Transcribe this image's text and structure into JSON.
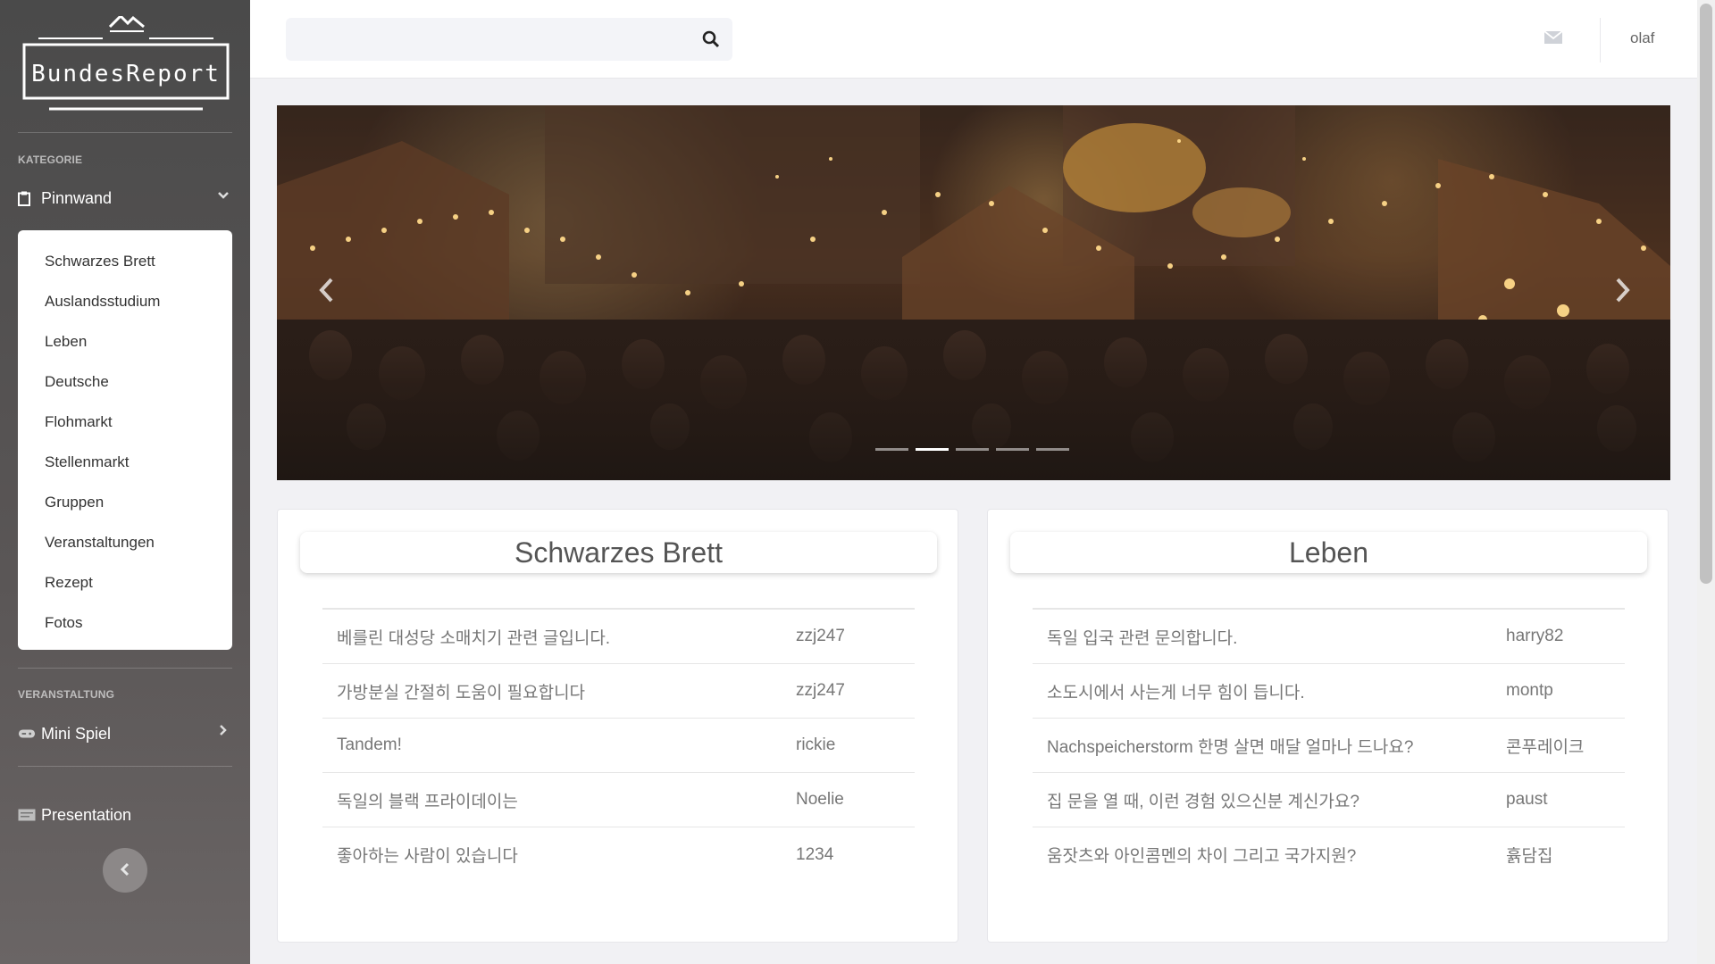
{
  "sidebar": {
    "logo_text": "BundesReport",
    "section_kategorie": "KATEGORIE",
    "pinnwand_label": "Pinnwand",
    "submenu": [
      "Schwarzes Brett",
      "Auslandsstudium",
      "Leben",
      "Deutsche",
      "Flohmarkt",
      "Stellenmarkt",
      "Gruppen",
      "Veranstaltungen",
      "Rezept",
      "Fotos"
    ],
    "section_veranstaltung": "VERANSTALTUNG",
    "mini_spiel_label": "Mini Spiel",
    "presentation_label": "Presentation",
    "icons": {
      "pinnwand": "clipboard-icon",
      "mini_spiel": "gamepad-icon",
      "presentation": "presentation-icon",
      "collapse": "chevron-left-icon"
    }
  },
  "header": {
    "search_placeholder": "",
    "search_value": "",
    "user_name": "olaf",
    "icons": {
      "search": "search-icon",
      "mail": "envelope-icon"
    }
  },
  "carousel": {
    "slide_count": 5,
    "active_index": 1
  },
  "cards": [
    {
      "title": "Schwarzes Brett",
      "posts": [
        {
          "title": "베를린 대성당 소매치기 관련 글입니다.",
          "author": "zzj247"
        },
        {
          "title": "가방분실 간절히 도움이 필요합니다",
          "author": "zzj247"
        },
        {
          "title": "Tandem!",
          "author": "rickie"
        },
        {
          "title": "독일의 블랙 프라이데이는",
          "author": "Noelie"
        },
        {
          "title": "좋아하는 사람이 있습니다",
          "author": "1234"
        }
      ]
    },
    {
      "title": "Leben",
      "posts": [
        {
          "title": "독일 입국 관련 문의합니다.",
          "author": "harry82"
        },
        {
          "title": "소도시에서 사는게 너무 힘이 듭니다.",
          "author": "montp"
        },
        {
          "title": "Nachspeicherstorm 한명 살면 매달 얼마나 드나요?",
          "author": "콘푸레이크"
        },
        {
          "title": "집 문을 열 때, 이런 경험 있으신분 계신가요?",
          "author": "paust"
        },
        {
          "title": "움잣츠와 아인콤멘의 차이 그리고 국가지원?",
          "author": "휽담집"
        }
      ]
    }
  ],
  "colors": {
    "sidebar_bg": "#4a4a4a",
    "page_bg": "#f1f1f4",
    "card_text": "#777777"
  }
}
